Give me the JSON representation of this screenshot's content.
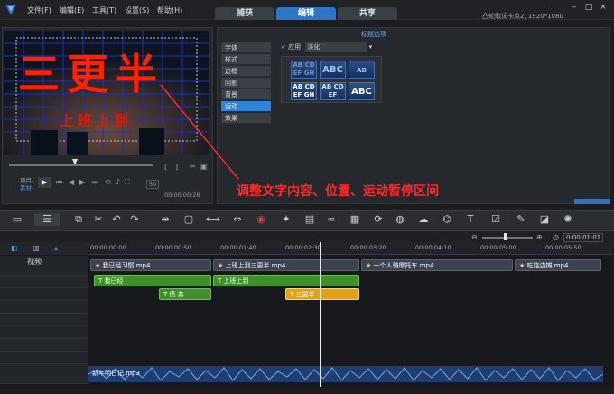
{
  "menu": {
    "file": "文件(F)",
    "edit": "编辑(E)",
    "tools": "工具(T)",
    "settings": "设置(S)",
    "help": "帮助(H)"
  },
  "tabs": {
    "capture": "捕获",
    "edit": "编辑",
    "share": "共享"
  },
  "project_info": "凸轮歌词卡点2, 1920*1080",
  "preview": {
    "title_big": "三更半",
    "title_small": "上班上到",
    "mode_project": "项目-",
    "mode_clip": "素材-",
    "timecode": "00:00:00:26",
    "zoom": "50"
  },
  "options": {
    "title": "标题选项",
    "side": [
      "字体",
      "样式",
      "边框",
      "阴影",
      "背景",
      "运动",
      "效果"
    ],
    "apply_label": "应用",
    "apply_value": "淡化",
    "presets": [
      "AB CD EF GH",
      "ABC",
      "AB",
      "AB CD EF GH",
      "AB CD EF",
      "ABC"
    ]
  },
  "annotation": "调整文字内容、位置、运动暂停区间",
  "timecode_right": "0:00:01:01",
  "ruler": [
    "00:00:00:00",
    "00:00:00:50",
    "00:00:01:40",
    "00:00:02:30",
    "00:00:03:20",
    "00:00:04:10",
    "00:00:05:00",
    "00:00:05:50"
  ],
  "tracks": {
    "video_label": "视频"
  },
  "clips": {
    "video": [
      {
        "name": "我已经习惯.mp4"
      },
      {
        "name": "上班上到三更半.mp4"
      },
      {
        "name": "一个人骑摩托车.mp4"
      },
      {
        "name": "吃路边摊.mp4"
      }
    ],
    "title1": [
      {
        "name": "我已经"
      },
      {
        "name": "上班上到"
      }
    ],
    "title2": [
      {
        "name": "债 务"
      },
      {
        "name": "三更半"
      }
    ],
    "audio": "新年明日记.mp3"
  },
  "colors": {
    "accent": "#2e74c8",
    "title_clip": "#3f8f2a",
    "selected_clip": "#e0a21a",
    "annotation": "#ff2a2a"
  }
}
